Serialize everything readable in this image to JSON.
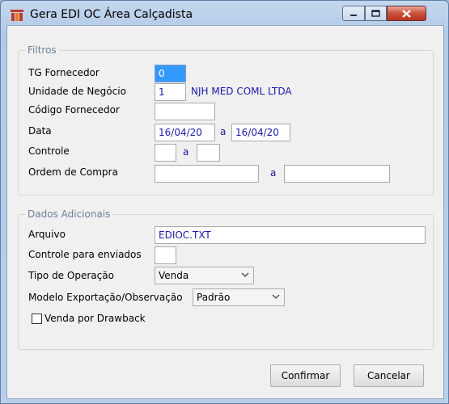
{
  "window": {
    "title": "Gera EDI OC Área Calçadista"
  },
  "filtros": {
    "legend": "Filtros",
    "tg_fornecedor": {
      "label": "TG Fornecedor",
      "value": "0"
    },
    "unidade_negocio": {
      "label": "Unidade de Negócio",
      "value": "1",
      "description": "NJH MED COML LTDA"
    },
    "codigo_fornecedor": {
      "label": "Código Fornecedor",
      "value": ""
    },
    "data": {
      "label": "Data",
      "from": "16/04/20",
      "separator": "a",
      "to": "16/04/20"
    },
    "controle": {
      "label": "Controle",
      "from": "",
      "separator": "a",
      "to": ""
    },
    "ordem_compra": {
      "label": "Ordem de Compra",
      "from": "",
      "separator": "a",
      "to": ""
    }
  },
  "dados": {
    "legend": "Dados Adicionais",
    "arquivo": {
      "label": "Arquivo",
      "value": "EDIOC.TXT"
    },
    "controle_enviados": {
      "label": "Controle para enviados",
      "value": ""
    },
    "tipo_operacao": {
      "label": "Tipo de Operação",
      "selected": "Venda"
    },
    "modelo_exportacao": {
      "label": "Modelo Exportação/Observação",
      "selected": "Padrão"
    },
    "venda_drawback": {
      "label": "Venda por Drawback",
      "checked": false
    }
  },
  "buttons": {
    "confirmar": "Confirmar",
    "cancelar": "Cancelar"
  }
}
